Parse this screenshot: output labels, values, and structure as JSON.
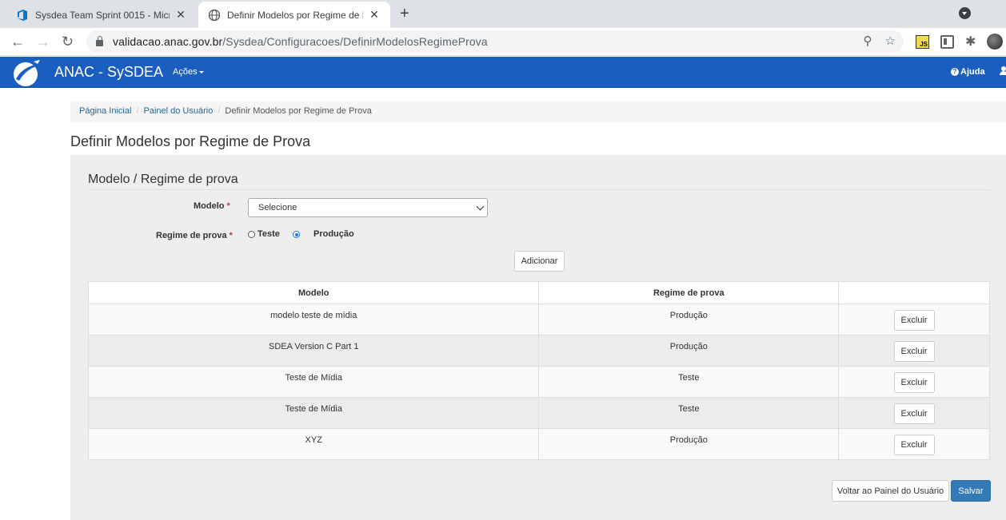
{
  "browser": {
    "tabs": [
      {
        "title": "Sysdea Team Sprint 0015 - Micro",
        "active": false
      },
      {
        "title": "Definir Modelos por Regime de P",
        "active": true
      }
    ],
    "url_host": "validacao.anac.gov.br",
    "url_path": "/Sysdea/Configuracoes/DefinirModelosRegimeProva"
  },
  "navbar": {
    "brand": "ANAC - SySDEA",
    "menu_acoes": "Ações",
    "help": "Ajuda"
  },
  "breadcrumb": {
    "items": [
      "Página Inicial",
      "Painel do Usuário"
    ],
    "current": "Definir Modelos por Regime de Prova"
  },
  "page": {
    "title": "Definir Modelos por Regime de Prova"
  },
  "form": {
    "legend": "Modelo / Regime de prova",
    "modelo_label": "Modelo",
    "required_mark": "*",
    "modelo_value": "Selecione",
    "regime_label": "Regime de prova",
    "regime_options": [
      {
        "label": "Teste",
        "checked": false
      },
      {
        "label": "Produção",
        "checked": true
      }
    ],
    "add_button": "Adicionar"
  },
  "table": {
    "headers": [
      "Modelo",
      "Regime de prova",
      ""
    ],
    "rows": [
      {
        "modelo": "modelo teste de mídia",
        "regime": "Produção",
        "action": "Excluir"
      },
      {
        "modelo": "SDEA Version C Part 1",
        "regime": "Produção",
        "action": "Excluir"
      },
      {
        "modelo": "Teste de Mídia",
        "regime": "Teste",
        "action": "Excluir"
      },
      {
        "modelo": "Teste de Mídia",
        "regime": "Teste",
        "action": "Excluir"
      },
      {
        "modelo": "XYZ",
        "regime": "Produção",
        "action": "Excluir"
      }
    ]
  },
  "footer_buttons": {
    "back": "Voltar ao Painel do Usuário",
    "save": "Salvar"
  },
  "colors": {
    "navbar": "#1a5fbf",
    "primary_button": "#337ab7",
    "panel_bg": "#eeeeee"
  }
}
